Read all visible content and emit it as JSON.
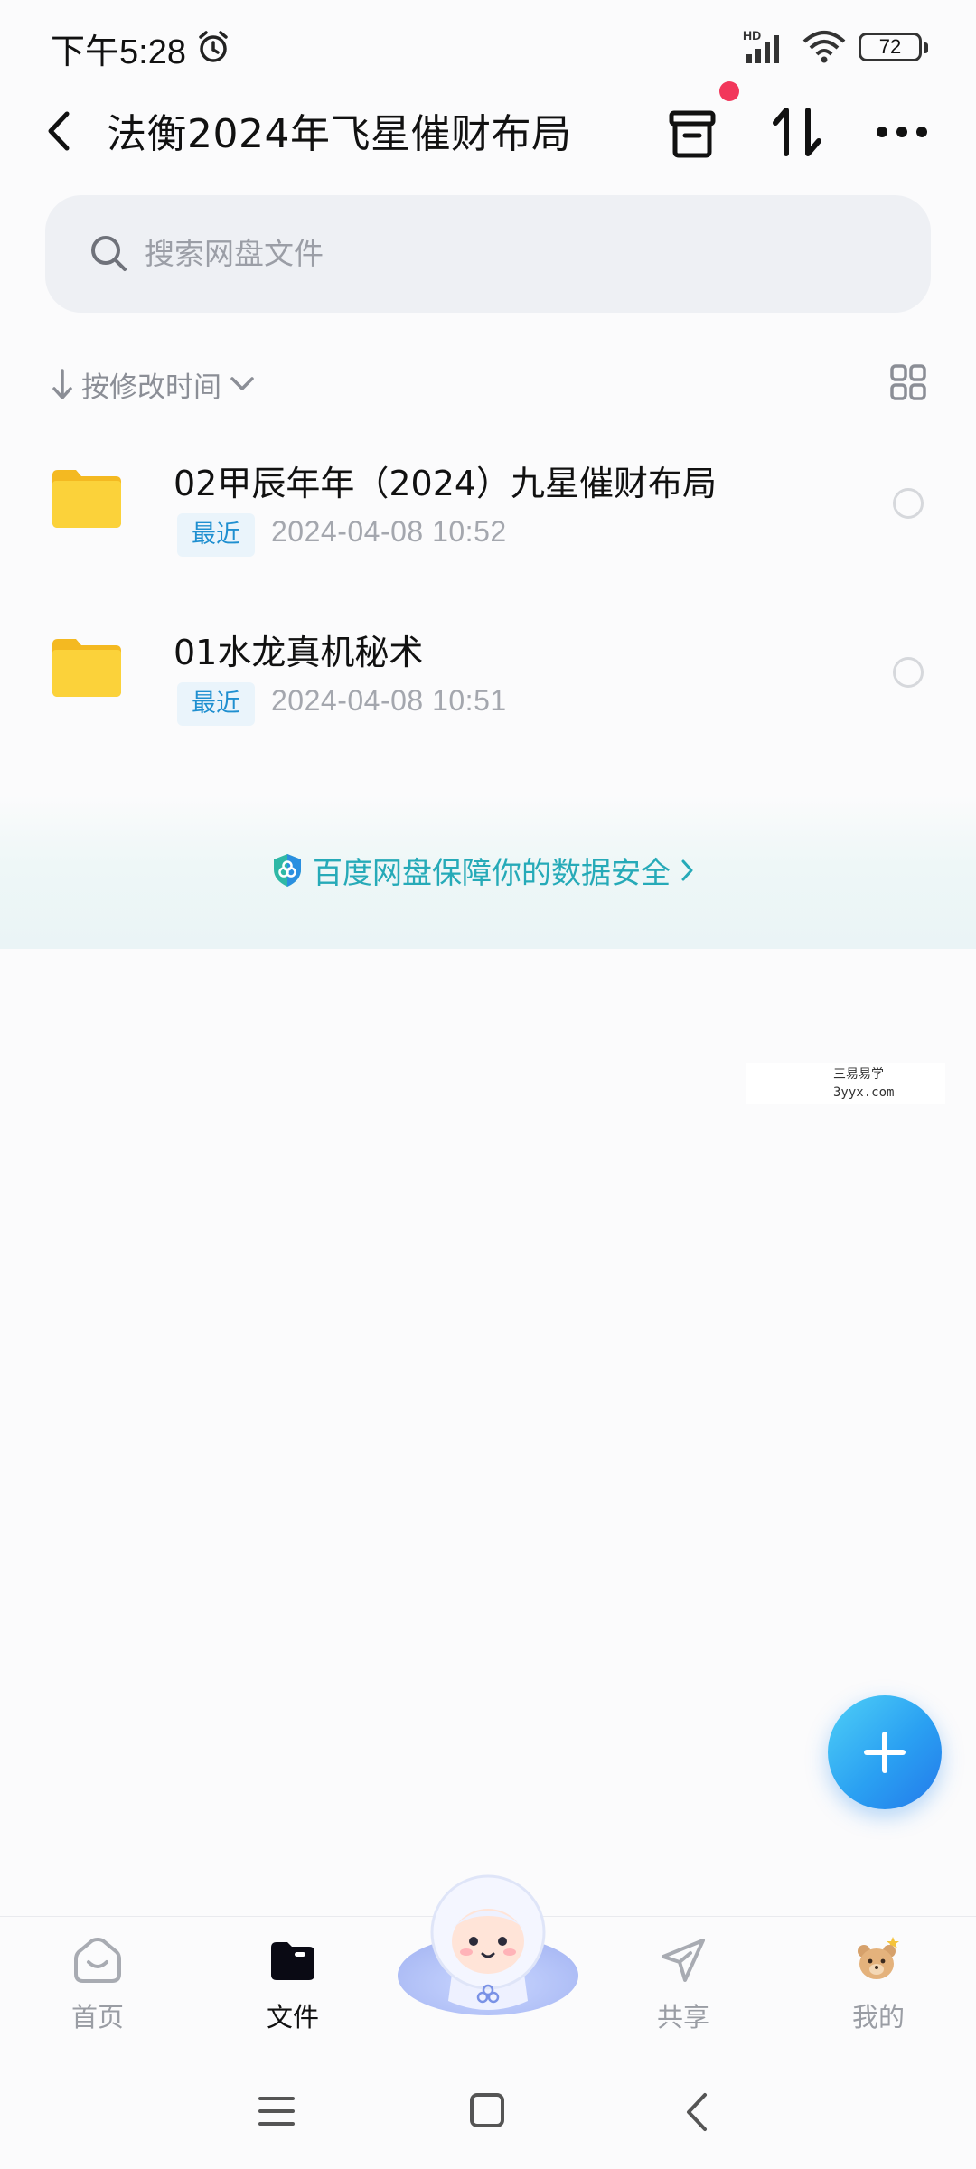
{
  "status_bar": {
    "time": "下午5:28",
    "battery": "72",
    "icons": [
      "alarm-icon",
      "signal-hd-icon",
      "wifi-icon",
      "battery-icon"
    ]
  },
  "header": {
    "title": "法衡2024年飞星催财布局",
    "icons": [
      "back-icon",
      "recycle-bin-icon",
      "transfer-icon",
      "more-icon"
    ]
  },
  "search": {
    "placeholder": "搜索网盘文件"
  },
  "sort": {
    "label": "按修改时间"
  },
  "files": [
    {
      "name": "02甲辰年年（2024）九星催财布局",
      "badge": "最近",
      "date": "2024-04-08  10:52"
    },
    {
      "name": "01水龙真机秘术",
      "badge": "最近",
      "date": "2024-04-08  10:51"
    }
  ],
  "banner": {
    "text": "百度网盘保障你的数据安全"
  },
  "watermark": {
    "line1": "三易易学",
    "line2": "3yyx.com"
  },
  "tabs": [
    {
      "label": "首页",
      "icon": "home-icon"
    },
    {
      "label": "文件",
      "icon": "folder-icon"
    },
    {
      "label": "共享",
      "icon": "share-icon"
    },
    {
      "label": "我的",
      "icon": "profile-icon"
    }
  ],
  "colors": {
    "accent": "#1f8fd0",
    "banner_text": "#26aab8",
    "fab": "#2aa0f2",
    "notification_dot": "#f2375b",
    "folder": "#f8c928"
  }
}
